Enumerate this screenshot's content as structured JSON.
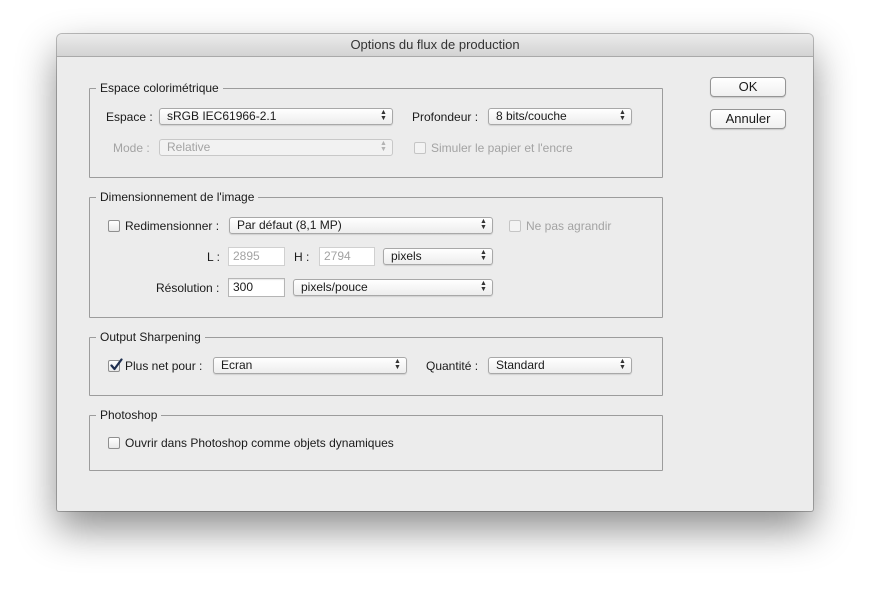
{
  "window": {
    "title": "Options du flux de production"
  },
  "buttons": {
    "ok": "OK",
    "cancel": "Annuler"
  },
  "color_space": {
    "legend": "Espace colorimétrique",
    "space_label": "Espace :",
    "space_value": "sRGB IEC61966-2.1",
    "depth_label": "Profondeur :",
    "depth_value": "8 bits/couche",
    "mode_label": "Mode :",
    "mode_value": "Relative",
    "simulate_label": "Simuler le papier et l'encre",
    "simulate_checked": false
  },
  "sizing": {
    "legend": "Dimensionnement de l'image",
    "resize_label": "Redimensionner :",
    "resize_checked": false,
    "resize_value": "Par défaut (8,1 MP)",
    "no_enlarge_label": "Ne pas agrandir",
    "width_label": "L :",
    "width_value": "2895",
    "height_label": "H :",
    "height_value": "2794",
    "units_value": "pixels",
    "resolution_label": "Résolution :",
    "resolution_value": "300",
    "resolution_units": "pixels/pouce"
  },
  "sharpening": {
    "legend": "Output Sharpening",
    "sharpen_label": "Plus net pour :",
    "sharpen_checked": true,
    "sharpen_value": "Ecran",
    "amount_label": "Quantité :",
    "amount_value": "Standard"
  },
  "photoshop": {
    "legend": "Photoshop",
    "smart_objects_label": "Ouvrir dans Photoshop comme objets dynamiques",
    "smart_objects_checked": false
  }
}
